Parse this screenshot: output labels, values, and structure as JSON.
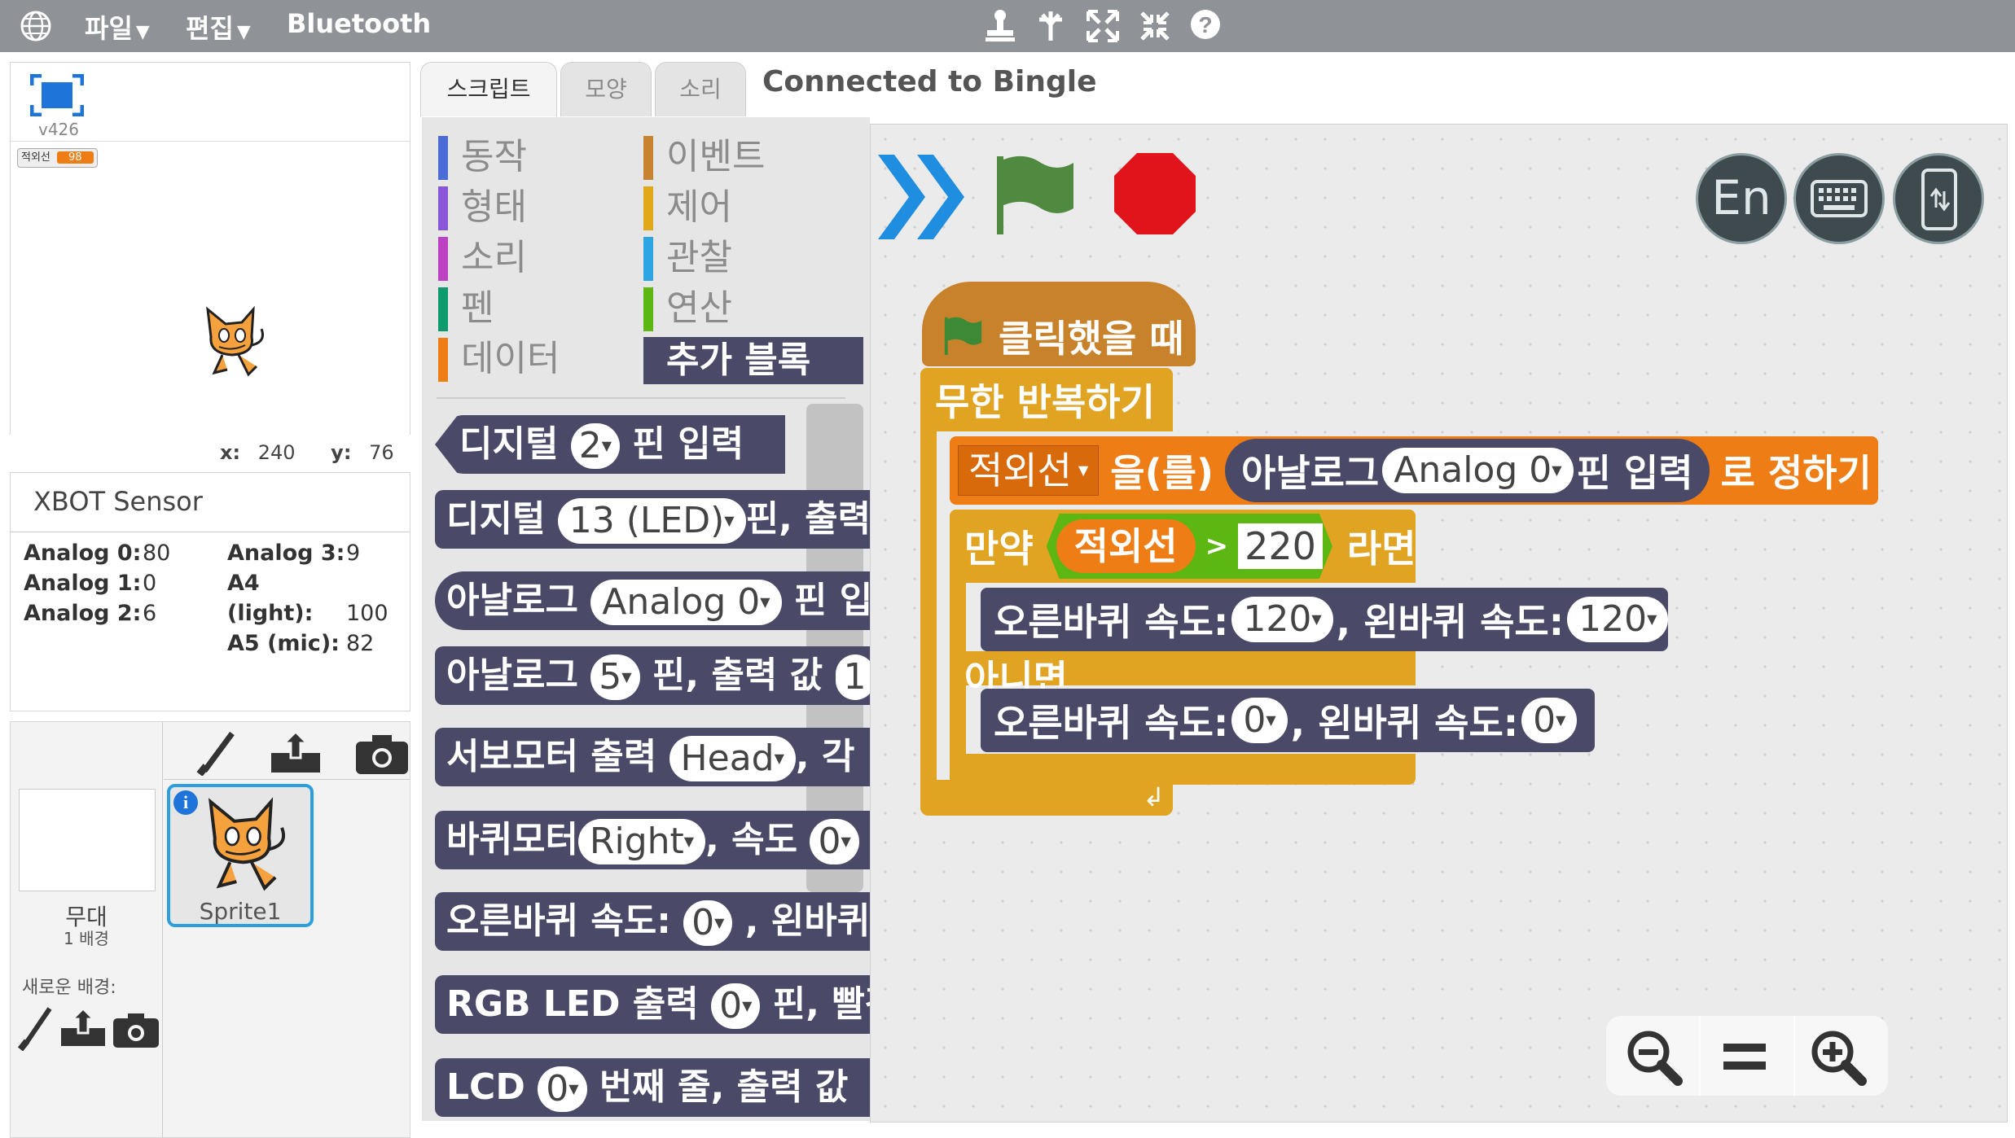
{
  "menubar": {
    "file_label": "파일",
    "edit_label": "편집",
    "bluetooth_label": "Bluetooth",
    "tool_icons": [
      "stamp-icon",
      "cut-icon",
      "grow-icon",
      "shrink-icon",
      "help-icon"
    ]
  },
  "stage": {
    "version": "v426",
    "variable_monitor": {
      "name": "적외선",
      "value": "98"
    },
    "coords": {
      "x_label": "x:",
      "x_value": "240",
      "y_label": "y:",
      "y_value": "76"
    }
  },
  "sensor_panel": {
    "title": "XBOT Sensor",
    "readings": [
      {
        "label": "Analog 0:",
        "value": "80"
      },
      {
        "label": "Analog 1:",
        "value": "0"
      },
      {
        "label": "Analog 2:",
        "value": "6"
      },
      {
        "label": "Analog 3:",
        "value": "9"
      },
      {
        "label": "A4 (light):",
        "value": "100"
      },
      {
        "label": "A5 (mic):",
        "value": "82"
      }
    ]
  },
  "sprites_panel": {
    "stage_label": "무대",
    "stage_sublabel": "1 배경",
    "new_backdrop_label": "새로운 배경:",
    "sprite_name": "Sprite1",
    "info_badge": "i"
  },
  "tabs": {
    "scripts": "스크립트",
    "costumes": "모양",
    "sounds": "소리"
  },
  "connection_status": "Connected to Bingle",
  "palette": {
    "categories_left": [
      {
        "label": "동작",
        "color": "#4a6cd4"
      },
      {
        "label": "형태",
        "color": "#8a55d7"
      },
      {
        "label": "소리",
        "color": "#bb42c3"
      },
      {
        "label": "펜",
        "color": "#0e9a6c"
      },
      {
        "label": "데이터",
        "color": "#ee7d16"
      }
    ],
    "categories_right": [
      {
        "label": "이벤트",
        "color": "#c88330"
      },
      {
        "label": "제어",
        "color": "#e1a91a"
      },
      {
        "label": "관찰",
        "color": "#2ca5e2"
      },
      {
        "label": "연산",
        "color": "#5cb712"
      },
      {
        "label": "추가 블록",
        "color": "#4a4a68"
      }
    ],
    "blocks": {
      "b1": {
        "t1": "디지털",
        "v1": "2",
        "t2": "핀 입력"
      },
      "b2": {
        "t1": "디지털",
        "v1": "13 (LED)",
        "t2": "핀, 출력"
      },
      "b3": {
        "t1": "아날로그",
        "v1": "Analog 0",
        "t2": "핀 입"
      },
      "b4": {
        "t1": "아날로그",
        "v1": "5",
        "t2": "핀, 출력 값",
        "v2": "1"
      },
      "b5": {
        "t1": "서보모터 출력",
        "v1": "Head",
        "t2": ", 각"
      },
      "b6": {
        "t1": "바퀴모터",
        "v1": "Right",
        "t2": ", 속도",
        "v2": "0"
      },
      "b7": {
        "t1": "오른바퀴 속도:",
        "v1": "0",
        "t2": ", 왼바퀴"
      },
      "b8": {
        "t1": "RGB LED 출력",
        "v1": "0",
        "t2": "핀, 빨강"
      },
      "b9": {
        "t1": "LCD",
        "v1": "0",
        "t2": "번째 줄, 출력 값"
      }
    }
  },
  "script": {
    "hat": "클릭했을 때",
    "forever": "무한 반복하기",
    "set_var": {
      "var": "적외선",
      "t1": "을(를)",
      "t2": "아날로그",
      "v1": "Analog 0",
      "t3": "핀 입력",
      "t4": "로 정하기"
    },
    "if_block": {
      "t1": "만약",
      "var": "적외선",
      "op": ">",
      "value": "220",
      "t2": "라면"
    },
    "wheel1": {
      "t1": "오른바퀴 속도:",
      "v1": "120",
      "t2": ", 왼바퀴 속도:",
      "v2": "120"
    },
    "else_label": "아니면",
    "wheel2": {
      "t1": "오른바퀴 속도:",
      "v1": "0",
      "t2": ", 왼바퀴 속도:",
      "v2": "0"
    }
  },
  "controls": {
    "lang_label": "En"
  }
}
